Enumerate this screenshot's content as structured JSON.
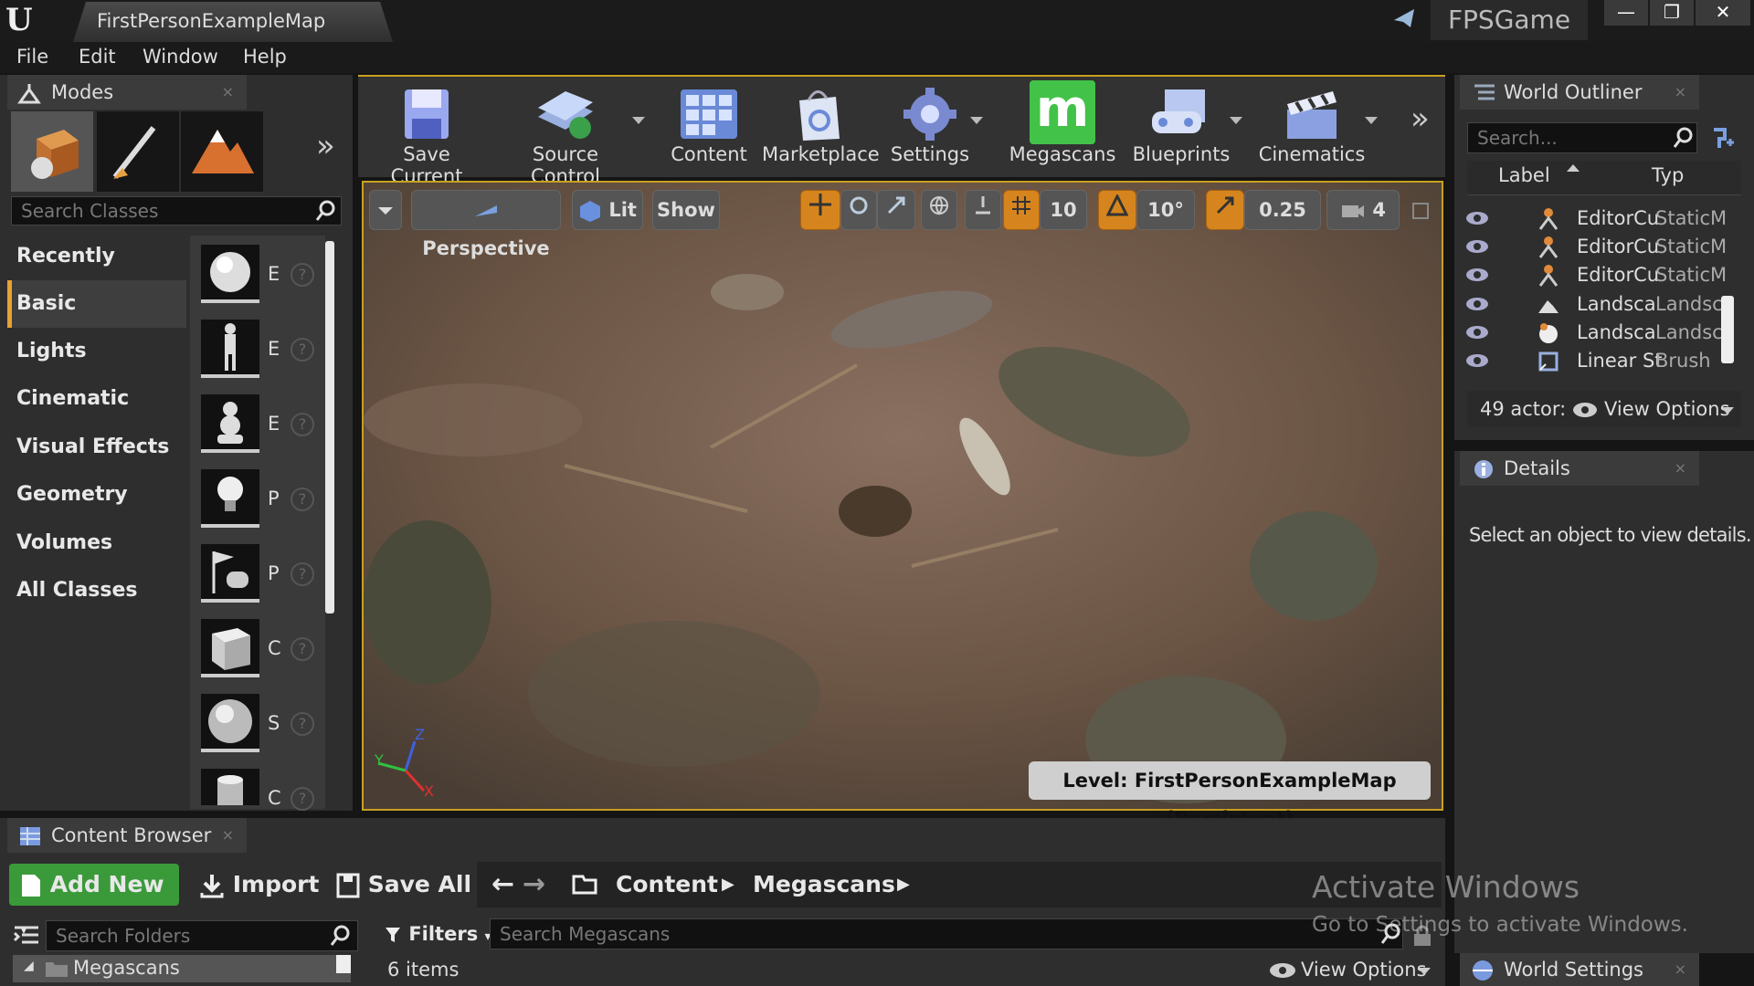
{
  "window": {
    "doc_tab": "FirstPersonExampleMap",
    "project": "FPSGame",
    "minimize": "—",
    "restore": "❐",
    "close": "✕"
  },
  "menu": [
    "File",
    "Edit",
    "Window",
    "Help"
  ],
  "modes_panel": {
    "tab_label": "Modes",
    "search_placeholder": "Search Classes",
    "categories": [
      "Recently Placed",
      "Basic",
      "Lights",
      "Cinematic",
      "Visual Effects",
      "Geometry",
      "Volumes",
      "All Classes"
    ],
    "selected_category": "Basic",
    "items": [
      {
        "letter": "E",
        "icon": "sphere-icon"
      },
      {
        "letter": "E",
        "icon": "character-icon"
      },
      {
        "letter": "E",
        "icon": "pawn-icon"
      },
      {
        "letter": "P",
        "icon": "light-bulb-icon"
      },
      {
        "letter": "P",
        "icon": "player-start-icon"
      },
      {
        "letter": "C",
        "icon": "cube-icon"
      },
      {
        "letter": "S",
        "icon": "sphere-icon"
      },
      {
        "letter": "C",
        "icon": "cylinder-icon"
      }
    ]
  },
  "toolbar": {
    "buttons": [
      {
        "label": "Save Current",
        "icon": "save-icon"
      },
      {
        "label": "Source Control",
        "icon": "source-control-icon"
      },
      {
        "label": "Content",
        "icon": "content-icon"
      },
      {
        "label": "Marketplace",
        "icon": "marketplace-icon"
      },
      {
        "label": "Settings",
        "icon": "settings-icon"
      },
      {
        "label": "Megascans",
        "icon": "megascans-icon"
      },
      {
        "label": "Blueprints",
        "icon": "blueprints-icon"
      },
      {
        "label": "Cinematics",
        "icon": "cinematics-icon"
      }
    ],
    "megascans_glyph": "m"
  },
  "viewport": {
    "perspective": "Perspective",
    "lit": "Lit",
    "show": "Show",
    "grid_snap": "10",
    "rotation_snap": "10°",
    "scale_snap": "0.25",
    "camera_speed": "4",
    "level_label": "Level:",
    "level_name": "FirstPersonExampleMap (Persistent)",
    "axis_z": "Z",
    "axis_y": "Y",
    "axis_x": "X"
  },
  "outliner": {
    "tab_label": "World Outliner",
    "search_placeholder": "Search...",
    "col_label": "Label",
    "col_type": "Typ",
    "rows": [
      {
        "label": "EditorCu",
        "type": "StaticM"
      },
      {
        "label": "EditorCu",
        "type": "StaticM"
      },
      {
        "label": "EditorCu",
        "type": "StaticM"
      },
      {
        "label": "Landsca",
        "type": "Landsc"
      },
      {
        "label": "Landsca",
        "type": "Landsc"
      },
      {
        "label": "Linear St",
        "type": "Brush"
      }
    ],
    "actor_count": "49 actor:",
    "view_options": "View Options"
  },
  "details": {
    "tab_label": "Details",
    "empty_message": "Select an object to view details."
  },
  "world_settings": {
    "tab_label": "World Settings"
  },
  "content_browser": {
    "tab_label": "Content Browser",
    "add_new": "Add New",
    "import": "Import",
    "save_all": "Save All",
    "path": [
      "Content",
      "Megascans"
    ],
    "search_folders_placeholder": "Search Folders",
    "filters": "Filters",
    "search_assets_placeholder": "Search Megascans",
    "folder": "Megascans",
    "item_count": "6 items",
    "view_options": "View Options"
  },
  "watermark": {
    "line1": "Activate Windows",
    "line2": "Go to Settings to activate Windows."
  },
  "colors": {
    "accent_orange": "#d6851e",
    "toolbar_border": "#c8a020",
    "add_new_green": "#3a9a3a"
  }
}
